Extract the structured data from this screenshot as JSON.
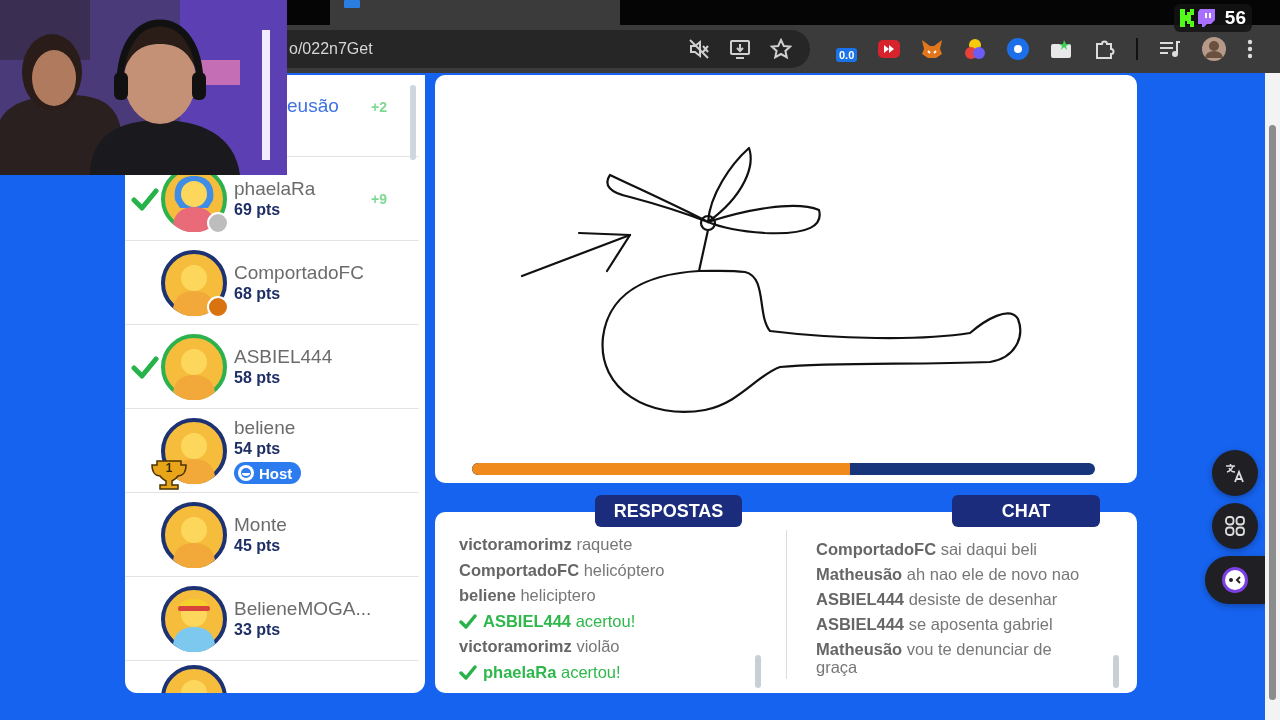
{
  "browser": {
    "address": "o/022n7Get",
    "extension_badge": "0.0"
  },
  "stream_overlay": {
    "viewer_count": "56"
  },
  "players": [
    {
      "kind": "covered",
      "name": "eusão",
      "gain": "+2",
      "highlighted": true
    },
    {
      "kind": "full",
      "name": "phaelaRa",
      "points": "69 pts",
      "guessed": true,
      "gain": "+9",
      "avatar": {
        "kind": "girl"
      },
      "color": "#bdbdbd"
    },
    {
      "kind": "full",
      "name": "ComportadoFC",
      "points": "68 pts",
      "guessed": false,
      "avatar": {
        "kind": "plain"
      },
      "color": "#d8730f"
    },
    {
      "kind": "full",
      "name": "ASBIEL444",
      "points": "58 pts",
      "guessed": true,
      "avatar": {
        "kind": "plain"
      }
    },
    {
      "kind": "full",
      "name": "beliene",
      "points": "54 pts",
      "guessed": false,
      "avatar": {
        "kind": "plain"
      },
      "rank": "1",
      "badge": "Host"
    },
    {
      "kind": "full",
      "name": "Monte",
      "points": "45 pts",
      "guessed": false,
      "avatar": {
        "kind": "plain"
      }
    },
    {
      "kind": "full",
      "name": "BelieneMOGA...",
      "points": "33 pts",
      "guessed": false,
      "avatar": {
        "kind": "cap"
      }
    },
    {
      "kind": "partial",
      "guessed": false,
      "avatar": {
        "kind": "plain"
      }
    }
  ],
  "canvas": {
    "timer": {
      "level": 0.607
    }
  },
  "answers": {
    "title": "RESPOSTAS",
    "entries": [
      {
        "kind": "guess",
        "user": "victoramorimz",
        "text": "raquete"
      },
      {
        "kind": "guess",
        "user": "ComportadoFC",
        "text": "helicóptero"
      },
      {
        "kind": "guess",
        "user": "beliene",
        "text": "heliciptero"
      },
      {
        "kind": "correct",
        "user": "ASBIEL444",
        "text": "acertou!"
      },
      {
        "kind": "guess",
        "user": "victoramorimz",
        "text": "violão"
      },
      {
        "kind": "correct",
        "user": "phaelaRa",
        "text": "acertou!"
      }
    ]
  },
  "chat": {
    "title": "CHAT",
    "messages": [
      {
        "user": "ComportadoFC",
        "text": "sai daqui beli"
      },
      {
        "user": "Matheusão",
        "text": "ah nao ele de novo nao"
      },
      {
        "user": "ASBIEL444",
        "text": "desiste de desenhar"
      },
      {
        "user": "ASBIEL444",
        "text": "se aposenta gabriel"
      },
      {
        "user": "Matheusão",
        "text": "vou te denunciar de graça"
      }
    ]
  }
}
